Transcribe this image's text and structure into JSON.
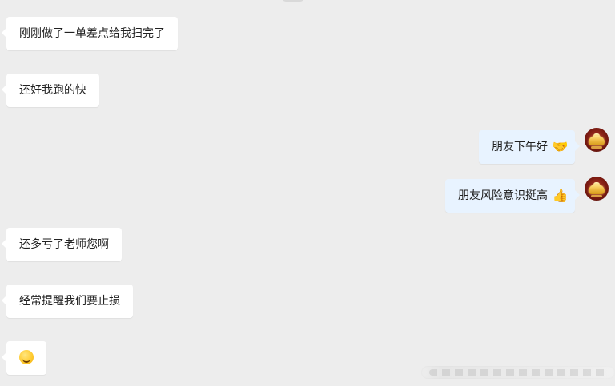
{
  "messages": [
    {
      "side": "left",
      "text": "刚刚做了一单差点给我扫完了"
    },
    {
      "side": "left",
      "text": "还好我跑的快"
    },
    {
      "side": "right",
      "text": "朋友下午好",
      "emoji": "🤝"
    },
    {
      "side": "right",
      "text": "朋友风险意识挺高",
      "emoji": "👍"
    },
    {
      "side": "left",
      "text": "还多亏了老师您啊"
    },
    {
      "side": "left",
      "text": "经常提醒我们要止损"
    },
    {
      "side": "left",
      "text": ""
    }
  ]
}
